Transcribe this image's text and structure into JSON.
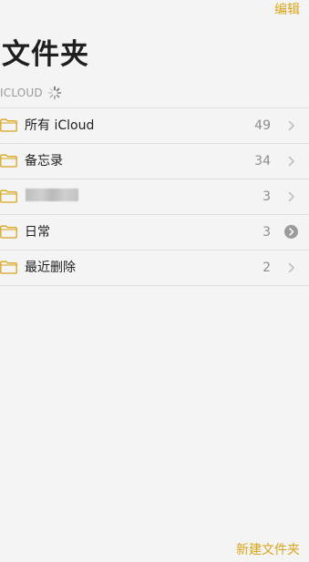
{
  "header": {
    "edit_label": "编辑",
    "title": "文件夹"
  },
  "section": {
    "label": "ICLOUD",
    "loading": true
  },
  "folders": [
    {
      "label": "所有 iCloud",
      "count": "49",
      "accessory": "chevron"
    },
    {
      "label": "备忘录",
      "count": "34",
      "accessory": "chevron"
    },
    {
      "label": "",
      "count": "3",
      "accessory": "chevron",
      "label_blurred": true
    },
    {
      "label": "日常",
      "count": "3",
      "accessory": "chevron-circle"
    },
    {
      "label": "最近删除",
      "count": "2",
      "accessory": "chevron"
    }
  ],
  "footer": {
    "new_folder_label": "新建文件夹"
  },
  "colors": {
    "accent": "#d8a51a",
    "background": "#f4f4f4",
    "separator": "#dedede",
    "count_text": "#8e8e8e"
  },
  "icons": {
    "folder": "folder-icon",
    "chevron": "chevron-right-icon",
    "spinner": "loading-spinner-icon"
  }
}
